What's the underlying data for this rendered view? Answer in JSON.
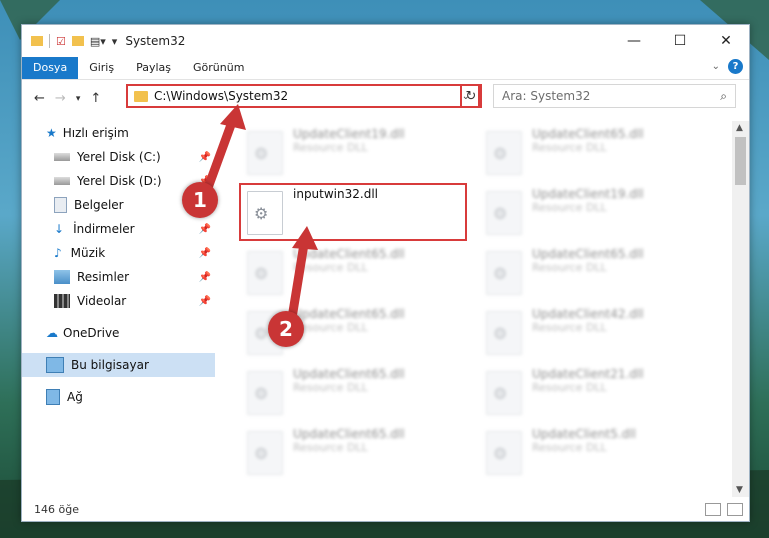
{
  "window": {
    "title": "System32"
  },
  "ribbon": {
    "tabs": [
      "Dosya",
      "Giriş",
      "Paylaş",
      "Görünüm"
    ]
  },
  "navbar": {
    "address": "C:\\Windows\\System32",
    "search_placeholder": "Ara: System32"
  },
  "sidebar": {
    "items": [
      {
        "label": "Hızlı erişim"
      },
      {
        "label": "Yerel Disk (C:)"
      },
      {
        "label": "Yerel Disk (D:)"
      },
      {
        "label": "Belgeler"
      },
      {
        "label": "İndirmeler"
      },
      {
        "label": "Müzik"
      },
      {
        "label": "Resimler"
      },
      {
        "label": "Videolar"
      },
      {
        "label": "OneDrive"
      },
      {
        "label": "Bu bilgisayar"
      },
      {
        "label": "Ağ"
      }
    ]
  },
  "files": [
    {
      "name": "UpdateClient19.dll",
      "type": "Resource DLL"
    },
    {
      "name": "UpdateClient65.dll",
      "type": "Resource DLL"
    },
    {
      "name": "inputwin32.dll",
      "type": ""
    },
    {
      "name": "UpdateClient19.dll",
      "type": "Resource DLL"
    },
    {
      "name": "UpdateClient65.dll",
      "type": "Resource DLL"
    },
    {
      "name": "UpdateClient65.dll",
      "type": "Resource DLL"
    },
    {
      "name": "UpdateClient65.dll",
      "type": "Resource DLL"
    },
    {
      "name": "UpdateClient42.dll",
      "type": "Resource DLL"
    },
    {
      "name": "UpdateClient65.dll",
      "type": "Resource DLL"
    },
    {
      "name": "UpdateClient21.dll",
      "type": "Resource DLL"
    },
    {
      "name": "UpdateClient65.dll",
      "type": "Resource DLL"
    },
    {
      "name": "UpdateClient5.dll",
      "type": "Resource DLL"
    }
  ],
  "status": {
    "count": "146 öğe"
  },
  "markers": [
    "1",
    "2"
  ],
  "colors": {
    "accent": "#1979ca",
    "highlight": "#d83b3b",
    "marker": "#c93535"
  }
}
